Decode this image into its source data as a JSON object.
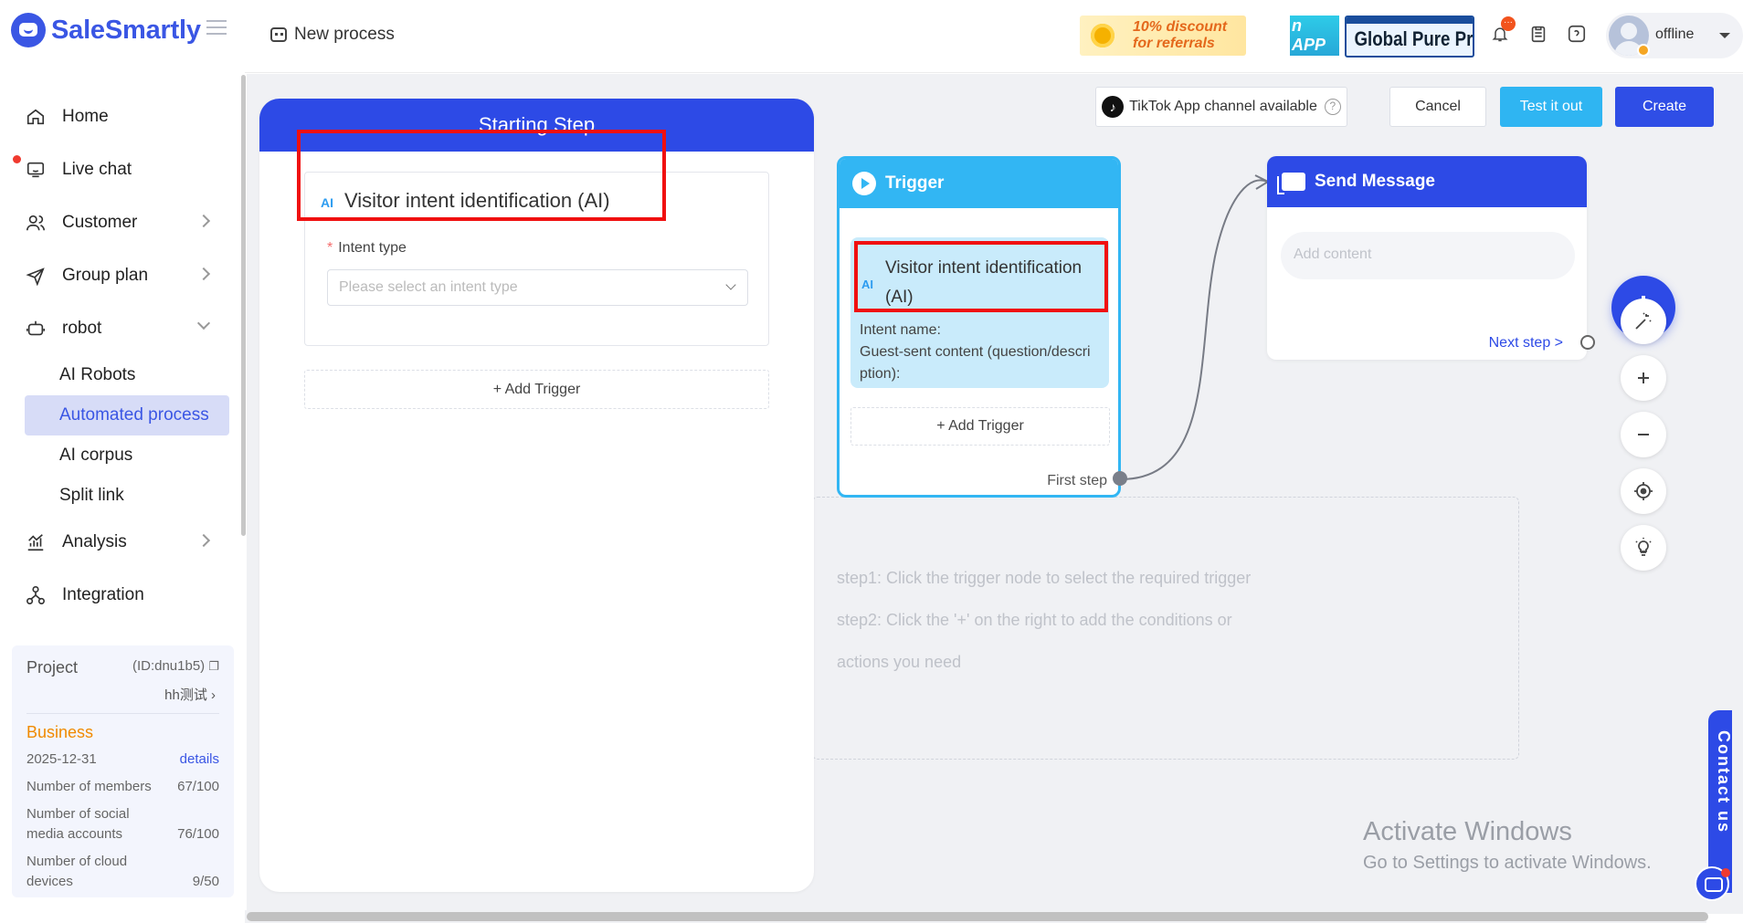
{
  "app": {
    "logo_text": "SaleSmartly"
  },
  "sidebar": {
    "items": [
      {
        "label": "Home",
        "icon": "home-icon"
      },
      {
        "label": "Live chat",
        "icon": "chat-icon"
      },
      {
        "label": "Customer",
        "icon": "users-icon"
      },
      {
        "label": "Group plan",
        "icon": "send-icon"
      },
      {
        "label": "robot",
        "icon": "robot-icon"
      },
      {
        "label": "Analysis",
        "icon": "chart-icon"
      },
      {
        "label": "Integration",
        "icon": "integration-icon"
      }
    ],
    "robot_sub": [
      "AI Robots",
      "Automated process",
      "AI corpus",
      "Split link"
    ],
    "active_sub": "Automated process",
    "project": {
      "label": "Project",
      "id": "(ID:dnu1b5)",
      "name": "hh测试",
      "plan": "Business",
      "expiry": "2025-12-31",
      "details": "details",
      "members_label": "Number of members",
      "members_value": "67/100",
      "social_label_1": "Number of social",
      "social_label_2": "media accounts",
      "social_value": "76/100",
      "cloud_label_1": "Number of cloud",
      "cloud_label_2": "devices",
      "cloud_value": "9/50"
    }
  },
  "header": {
    "title": "New process",
    "banner1_line1": "10% discount",
    "banner1_line2": "for referrals",
    "banner2": "n APP",
    "banner3": "Global Pure Pr",
    "notification_count": "···",
    "user_status": "offline"
  },
  "toolbar": {
    "tiktok_label": "TikTok App channel available",
    "cancel": "Cancel",
    "test": "Test it out",
    "create": "Create"
  },
  "start_step": {
    "title": "Starting Step",
    "ai_badge": "AI",
    "card_title": "Visitor intent identification (AI)",
    "intent_label": "Intent type",
    "select_placeholder": "Please select an intent type",
    "add_trigger": "+ Add Trigger"
  },
  "trigger_node": {
    "title": "Trigger",
    "ai_badge": "AI",
    "card_title_1": "Visitor intent identification",
    "card_title_2": "(AI)",
    "detail_1": "Intent name:",
    "detail_2": "Guest-sent content (question/descri",
    "detail_3": "ption):",
    "add_trigger": "+ Add Trigger",
    "first_step": "First step"
  },
  "send_node": {
    "title": "Send Message",
    "placeholder": "Add content",
    "next_step": "Next step >"
  },
  "hints": {
    "line1": "step1: Click the trigger node to select the required trigger",
    "line2": "step2: Click the '+' on the right to add the conditions or",
    "line3": "actions you need"
  },
  "watermark": {
    "line1": "Activate Windows",
    "line2": "Go to Settings to activate Windows."
  },
  "contact": {
    "label": "Contact us"
  },
  "colors": {
    "primary": "#2d4ae6",
    "trigger": "#32b6f3",
    "highlight_frame": "#f01010"
  }
}
